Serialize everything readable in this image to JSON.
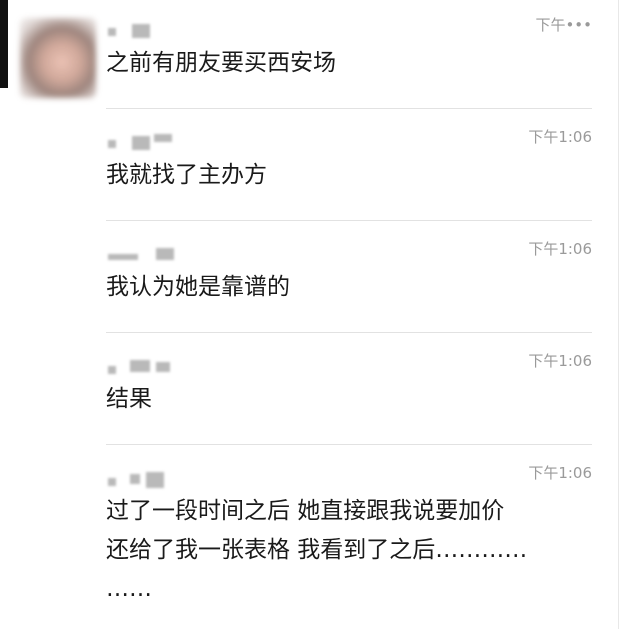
{
  "messages": [
    {
      "time": "下午•••",
      "text": "之前有朋友要买西安场"
    },
    {
      "time": "下午1:06",
      "text": "我就找了主办方"
    },
    {
      "time": "下午1:06",
      "text": "我认为她是靠谱的"
    },
    {
      "time": "下午1:06",
      "text": "结果"
    },
    {
      "time": "下午1:06",
      "text": "过了一段时间之后 她直接跟我说要加价\n还给了我一张表格 我看到了之后…………\n……"
    }
  ]
}
